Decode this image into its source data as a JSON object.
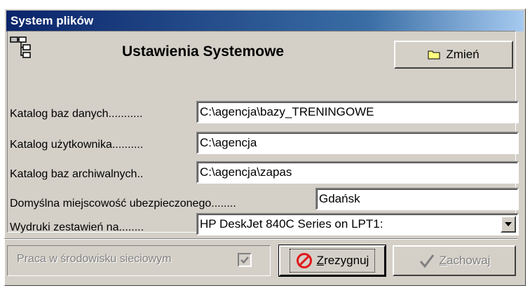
{
  "window": {
    "title": "System plików"
  },
  "header": {
    "title": "Ustawienia Systemowe",
    "change_button": "Zmień"
  },
  "fields": {
    "db_dir": {
      "label": "Katalog baz danych...........",
      "value": "C:\\agencja\\bazy_TRENINGOWE"
    },
    "user_dir": {
      "label": "Katalog użytkownika..........",
      "value": "C:\\agencja"
    },
    "archive_dir": {
      "label": "Katalog baz archiwalnych..",
      "value": "C:\\agencja\\zapas"
    },
    "default_city": {
      "label": "Domyślna miejscowość ubezpieczonego........",
      "value": "Gdańsk"
    },
    "printer": {
      "label": "Wydruki zestawień na........",
      "value": "HP DeskJet 840C Series on LPT1:"
    }
  },
  "footer": {
    "network_label": "Praca w środowisku sieciowym",
    "network_checked": true,
    "cancel_first_letter": "Z",
    "cancel_rest": "rezygnuj",
    "save_first_letter": "Z",
    "save_rest": "achowaj"
  },
  "colors": {
    "face": "#d4d0c8",
    "title_gradient_start": "#0a246a",
    "title_gradient_end": "#a6caf0",
    "cancel_icon": "#e0181c",
    "disabled_text": "#808080"
  },
  "icons": [
    "tree-structure-icon",
    "folder-icon",
    "no-entry-icon",
    "checkmark-icon",
    "dropdown-arrow-icon"
  ]
}
